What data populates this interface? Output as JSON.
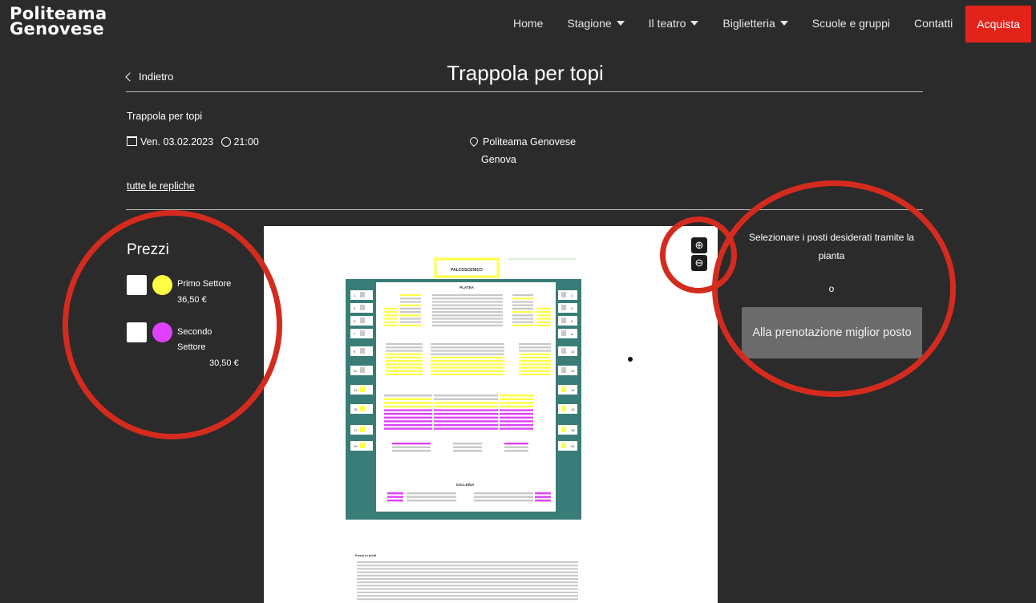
{
  "header": {
    "logo_line1": "Politeama",
    "logo_line2": "Genovese",
    "nav": [
      {
        "label": "Home",
        "dropdown": false
      },
      {
        "label": "Stagione",
        "dropdown": true
      },
      {
        "label": "Il teatro",
        "dropdown": true
      },
      {
        "label": "Biglietteria",
        "dropdown": true
      },
      {
        "label": "Scuole e gruppi",
        "dropdown": false
      },
      {
        "label": "Contatti",
        "dropdown": false
      }
    ],
    "buy_label": "Acquista",
    "buy_color": "#e2231a"
  },
  "page": {
    "back_label": "Indietro",
    "title": "Trappola per topi"
  },
  "event": {
    "name": "Trappola per topi",
    "date": "Ven. 03.02.2023",
    "time": "21:00",
    "venue": "Politeama Genovese",
    "city": "Genova",
    "all_dates_link": "tutte le repliche"
  },
  "prices": {
    "heading": "Prezzi",
    "items": [
      {
        "sector": "Primo Settore",
        "price": "36,50 €",
        "color": "#ffff44"
      },
      {
        "sector": "Secondo Settore",
        "sector_line1": "Secondo",
        "sector_line2": "Settore",
        "price": "30,50 €",
        "color": "#e040fb"
      }
    ]
  },
  "seat_map": {
    "stage_label": "PALCOSCENICO",
    "platea_label": "PLATEA",
    "galleria_label": "GALLERIA",
    "standing_label": "Posto in piedi",
    "zoom_in_icon": "zoom-in-icon",
    "zoom_out_icon": "zoom-out-icon",
    "frame_color": "#3a7d78",
    "seat_gray": "#c8c8c8",
    "seat_yellow": "#ffff44",
    "seat_magenta": "#e040fb",
    "box_numbers_left": [
      "1",
      "3",
      "5",
      "7",
      "9",
      "11",
      "13",
      "15",
      "17",
      "19"
    ],
    "box_numbers_right": [
      "2",
      "4",
      "6",
      "8",
      "10",
      "12",
      "14",
      "16",
      "18",
      "20"
    ]
  },
  "right_panel": {
    "instruction": "Selezionare i posti desiderati tramite la pianta",
    "or": "o",
    "best_seat_button": "Alla prenotazione miglior posto"
  },
  "annotation_color": "#d52b1e"
}
